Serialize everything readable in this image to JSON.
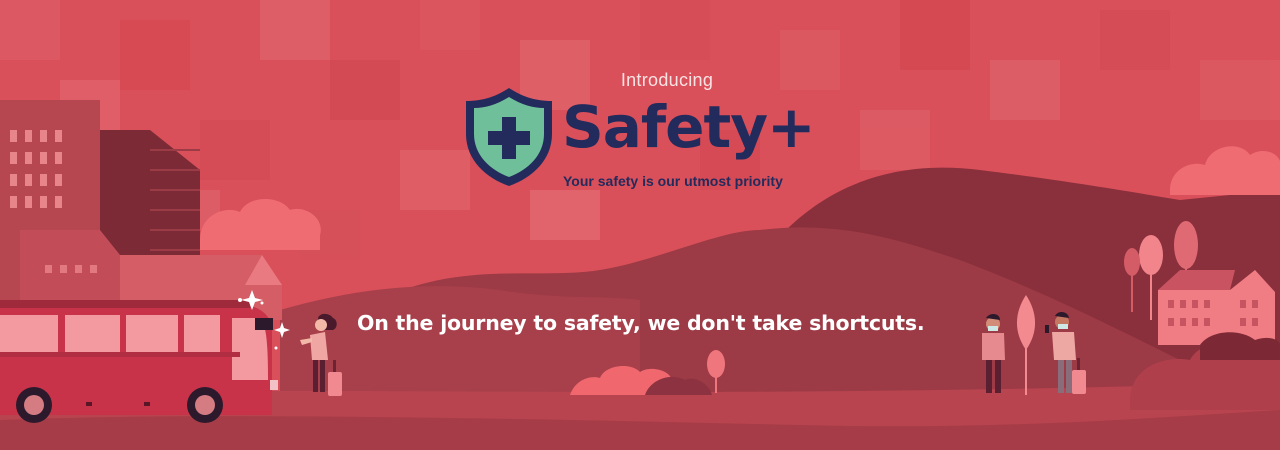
{
  "banner": {
    "intro": "Introducing",
    "brand_name": "Safety+",
    "tagline": "Your safety is our utmost priority",
    "headline": "On the journey to safety, we don't take shortcuts."
  },
  "icons": {
    "logo": "shield-plus-icon",
    "sparkle": "sparkle-icon"
  },
  "colors": {
    "background": "#d9505a",
    "brand_navy": "#232a5c",
    "shield_green": "#6fbf9a",
    "hill_dark": "#7f2a36",
    "ground": "#b8444f"
  }
}
